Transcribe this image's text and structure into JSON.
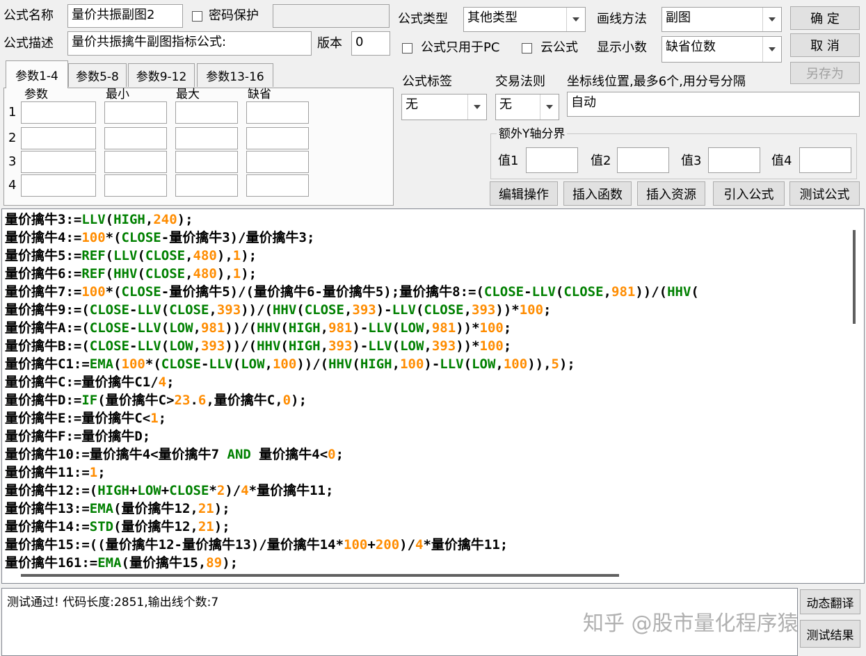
{
  "formula": {
    "name_label": "公式名称",
    "name_value": "量价共振副图2",
    "password_label": "密码保护",
    "password_value": "",
    "desc_label": "公式描述",
    "desc_value": "量价共振擒牛副图指标公式:",
    "version_label": "版本",
    "version_value": "0"
  },
  "right": {
    "type_label": "公式类型",
    "type_value": "其他类型",
    "draw_label": "画线方法",
    "draw_value": "副图",
    "pc_only_label": "公式只用于PC",
    "cloud_label": "云公式",
    "decimals_label": "显示小数",
    "decimals_value": "缺省位数",
    "tag_label": "公式标签",
    "tag_value": "无",
    "rule_label": "交易法则",
    "rule_value": "无",
    "axis_label": "坐标线位置,最多6个,用分号分隔",
    "axis_value": "自动",
    "y_group_label": "额外Y轴分界",
    "y_vals": [
      "值1",
      "值2",
      "值3",
      "值4"
    ]
  },
  "buttons": {
    "ok": "确 定",
    "cancel": "取 消",
    "save_as": "另存为",
    "edit_ops": "编辑操作",
    "insert_func": "插入函数",
    "insert_res": "插入资源",
    "import_formula": "引入公式",
    "test_formula": "测试公式",
    "dyn_translate": "动态翻译",
    "test_result": "测试结果"
  },
  "params": {
    "tabs": [
      "参数1-4",
      "参数5-8",
      "参数9-12",
      "参数13-16"
    ],
    "headers": [
      "参数",
      "最小",
      "最大",
      "缺省"
    ],
    "rows": [
      "1",
      "2",
      "3",
      "4"
    ]
  },
  "status": "测试通过! 代码长度:2851,输出线个数:7",
  "watermark": "知乎 @股市量化程序猿"
}
